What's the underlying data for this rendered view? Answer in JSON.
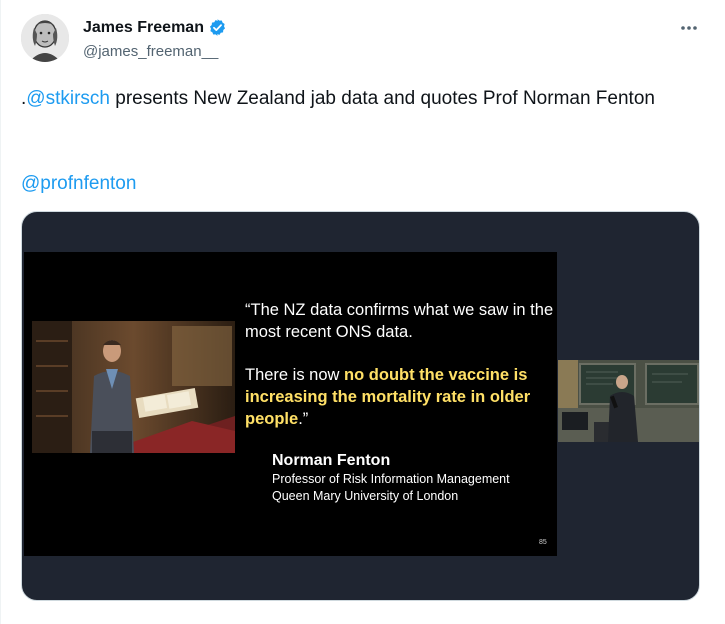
{
  "author": {
    "display_name": "James Freeman",
    "handle": "@james_freeman__",
    "avatar_icon": "portrait-avatar",
    "verified_icon": "verified-badge-icon",
    "verified_color": "#1d9bf0"
  },
  "more_icon": "more-horizontal-icon",
  "tweet": {
    "prefix": ".",
    "mention1": "@stkirsch",
    "text": " presents New Zealand jab data and quotes Prof Norman Fenton",
    "mention2": "@profnfenton",
    "link_color": "#1d9bf0"
  },
  "slide": {
    "quote_line1": "“The NZ data confirms what we saw in the most recent ONS data.",
    "quote_line2_plain": "There is now ",
    "quote_line2_highlight": "no doubt the vaccine is increasing the mortality rate in older people",
    "quote_line2_end": ".”",
    "speaker_name": "Norman Fenton",
    "speaker_title": "Professor of Risk Information Management",
    "speaker_org": "Queen Mary University of London",
    "slide_number": "85",
    "highlight_color": "#ffe066"
  }
}
